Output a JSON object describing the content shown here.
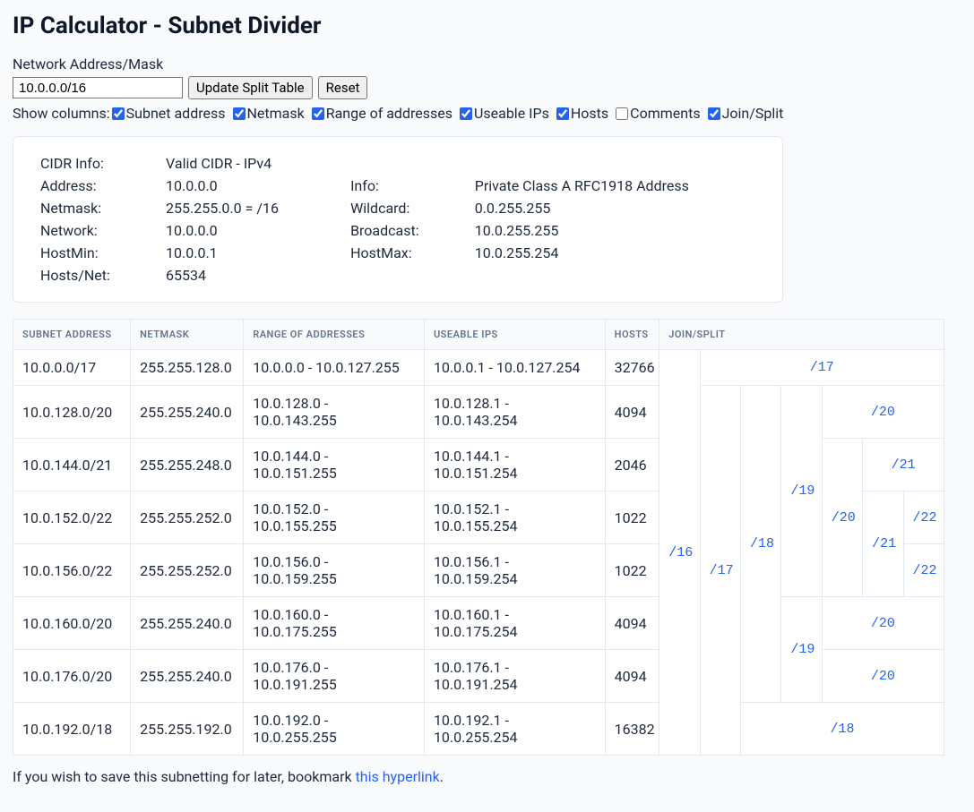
{
  "page_title": "IP Calculator - Subnet Divider",
  "form": {
    "network_label": "Network Address/Mask",
    "network_value": "10.0.0.0/16",
    "update_button": "Update Split Table",
    "reset_button": "Reset"
  },
  "columns_control": {
    "label": "Show columns:",
    "items": [
      {
        "label": "Subnet address",
        "checked": true
      },
      {
        "label": "Netmask",
        "checked": true
      },
      {
        "label": "Range of addresses",
        "checked": true
      },
      {
        "label": "Useable IPs",
        "checked": true
      },
      {
        "label": "Hosts",
        "checked": true
      },
      {
        "label": "Comments",
        "checked": false
      },
      {
        "label": "Join/Split",
        "checked": true
      }
    ]
  },
  "cidr_info": {
    "labels": {
      "cidr_info": "CIDR Info:",
      "address": "Address:",
      "info": "Info:",
      "netmask": "Netmask:",
      "wildcard": "Wildcard:",
      "network": "Network:",
      "broadcast": "Broadcast:",
      "hostmin": "HostMin:",
      "hostmax": "HostMax:",
      "hostsnet": "Hosts/Net:"
    },
    "values": {
      "cidr_info": "Valid CIDR - IPv4",
      "address": "10.0.0.0",
      "info": "Private Class A RFC1918 Address",
      "netmask": "255.255.0.0 = /16",
      "wildcard": "0.0.255.255",
      "network": "10.0.0.0",
      "broadcast": "10.0.255.255",
      "hostmin": "10.0.0.1",
      "hostmax": "10.0.255.254",
      "hostsnet": "65534"
    }
  },
  "table": {
    "headers": {
      "subnet": "Subnet address",
      "netmask": "Netmask",
      "range": "Range of addresses",
      "useable": "Useable IPs",
      "hosts": "Hosts",
      "joinsplit": "Join/Split"
    },
    "rows": [
      {
        "subnet": "10.0.0.0/17",
        "netmask": "255.255.128.0",
        "range": "10.0.0.0 - 10.0.127.255",
        "useable": "10.0.0.1 - 10.0.127.254",
        "hosts": "32766"
      },
      {
        "subnet": "10.0.128.0/20",
        "netmask": "255.255.240.0",
        "range": "10.0.128.0 - 10.0.143.255",
        "useable": "10.0.128.1 - 10.0.143.254",
        "hosts": "4094"
      },
      {
        "subnet": "10.0.144.0/21",
        "netmask": "255.255.248.0",
        "range": "10.0.144.0 - 10.0.151.255",
        "useable": "10.0.144.1 - 10.0.151.254",
        "hosts": "2046"
      },
      {
        "subnet": "10.0.152.0/22",
        "netmask": "255.255.252.0",
        "range": "10.0.152.0 - 10.0.155.255",
        "useable": "10.0.152.1 - 10.0.155.254",
        "hosts": "1022"
      },
      {
        "subnet": "10.0.156.0/22",
        "netmask": "255.255.252.0",
        "range": "10.0.156.0 - 10.0.159.255",
        "useable": "10.0.156.1 - 10.0.159.254",
        "hosts": "1022"
      },
      {
        "subnet": "10.0.160.0/20",
        "netmask": "255.255.240.0",
        "range": "10.0.160.0 - 10.0.175.255",
        "useable": "10.0.160.1 - 10.0.175.254",
        "hosts": "4094"
      },
      {
        "subnet": "10.0.176.0/20",
        "netmask": "255.255.240.0",
        "range": "10.0.176.0 - 10.0.191.255",
        "useable": "10.0.176.1 - 10.0.191.254",
        "hosts": "4094"
      },
      {
        "subnet": "10.0.192.0/18",
        "netmask": "255.255.192.0",
        "range": "10.0.192.0 - 10.0.255.255",
        "useable": "10.0.192.1 - 10.0.255.254",
        "hosts": "16382"
      }
    ],
    "joinsplit": {
      "c16": "/16",
      "c17a": "/17",
      "c17b": "/17",
      "c18a": "/18",
      "c18b": "/18",
      "c19a": "/19",
      "c19b": "/19",
      "c20a": "/20",
      "c20b": "/20",
      "c20c": "/20",
      "c20d": "/20",
      "c21a": "/21",
      "c21b": "/21",
      "c22a": "/22",
      "c22b": "/22"
    }
  },
  "footer": {
    "text": "If you wish to save this subnetting for later, bookmark ",
    "link": "this hyperlink",
    "suffix": "."
  }
}
